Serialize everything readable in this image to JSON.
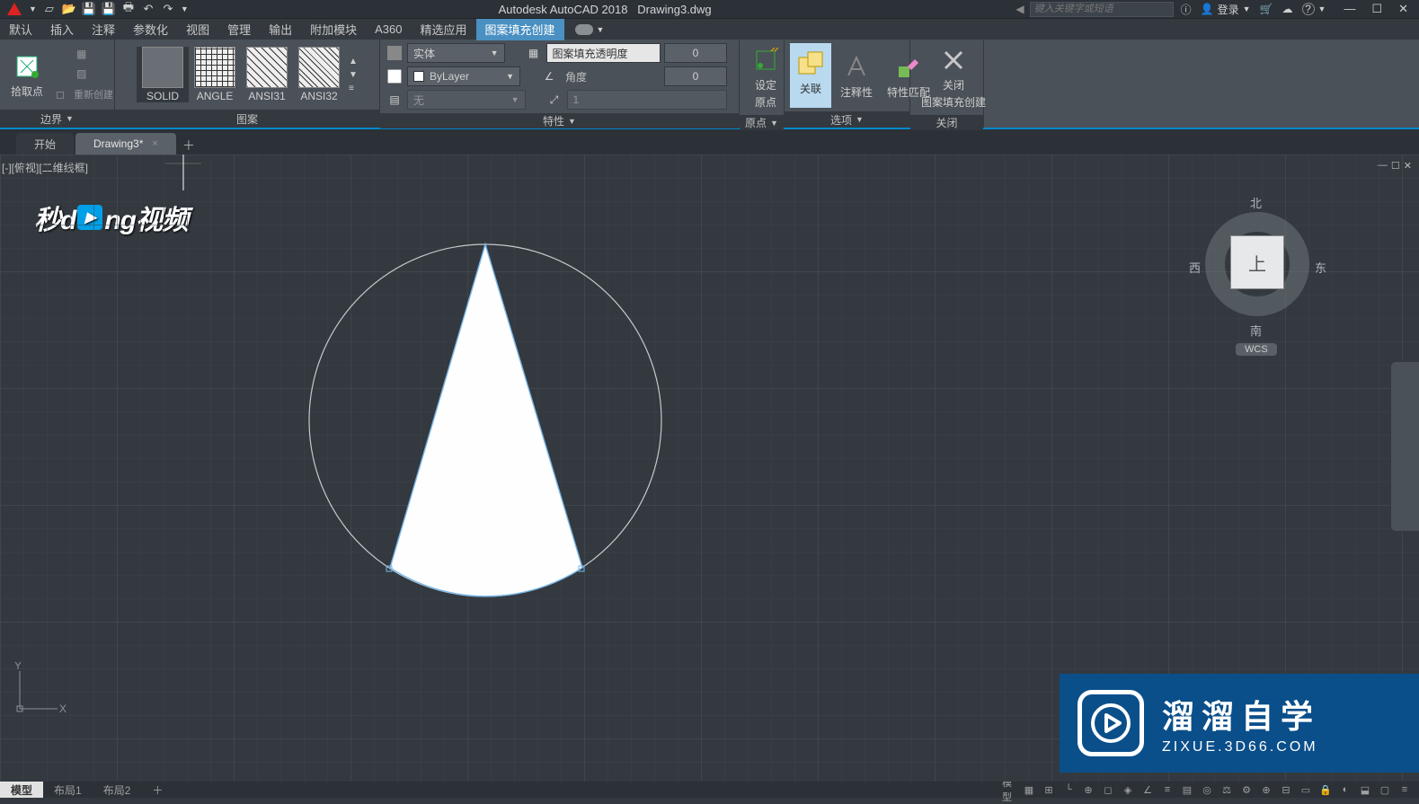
{
  "title": {
    "app": "Autodesk AutoCAD 2018",
    "doc": "Drawing3.dwg"
  },
  "search": {
    "placeholder": "键入关键字或短语"
  },
  "account": {
    "login": "登录"
  },
  "window": {
    "min": "—",
    "max": "☐",
    "close": "✕"
  },
  "menus": [
    "默认",
    "插入",
    "注释",
    "参数化",
    "视图",
    "管理",
    "输出",
    "附加模块",
    "A360",
    "精选应用",
    "图案填充创建"
  ],
  "active_menu_index": 10,
  "ribbon": {
    "boundary": {
      "pick": "拾取点",
      "recreate": "重新创建",
      "panel": "边界"
    },
    "patterns": {
      "items": [
        "SOLID",
        "ANGLE",
        "ANSI31",
        "ANSI32"
      ],
      "panel": "图案"
    },
    "properties": {
      "type_label": "实体",
      "color_label": "ByLayer",
      "none_label": "无",
      "trans_label": "图案填充透明度",
      "trans_val": "0",
      "angle_label": "角度",
      "angle_val": "0",
      "scale_val": "1",
      "panel": "特性"
    },
    "origin": {
      "label1": "设定",
      "label2": "原点",
      "panel": "原点"
    },
    "assoc": {
      "label": "关联"
    },
    "annot": {
      "label": "注释性"
    },
    "match": {
      "label": "特性匹配"
    },
    "options_panel": "选项",
    "close": {
      "label1": "关闭",
      "label2": "图案填充创建",
      "panel": "关闭"
    }
  },
  "tabs": {
    "start": "开始",
    "drawing": "Drawing3*"
  },
  "viewport": {
    "label": "[-][俯视][二维线框]"
  },
  "viewcube": {
    "n": "北",
    "s": "南",
    "e": "东",
    "w": "西",
    "top": "上",
    "wcs": "WCS"
  },
  "wm_top": {
    "a": "秒d",
    "b": "ng视频"
  },
  "wm_bottom": {
    "title": "溜溜自学",
    "sub": "ZIXUE.3D66.COM"
  },
  "ucs": {
    "x": "X",
    "y": "Y"
  },
  "layouts": [
    "模型",
    "布局1",
    "布局2"
  ],
  "icons": {
    "chev_down": "▼",
    "plus": "＋",
    "close_x": "×",
    "help": "?",
    "play": "▶"
  }
}
